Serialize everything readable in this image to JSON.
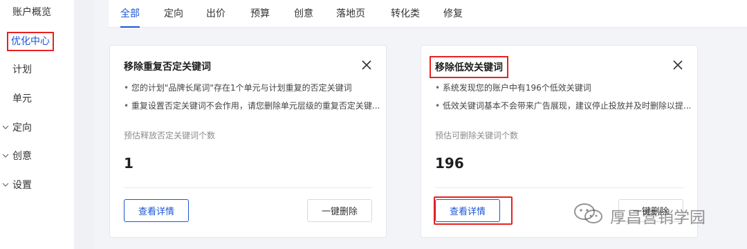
{
  "sidebar": {
    "items": [
      {
        "label": "账户概览"
      },
      {
        "label": "优化中心"
      },
      {
        "label": "计划"
      },
      {
        "label": "单元"
      }
    ],
    "groups": [
      {
        "label": "定向",
        "icon": "chevron-down-icon"
      },
      {
        "label": "创意",
        "icon": "chevron-down-icon"
      },
      {
        "label": "设置",
        "icon": "chevron-down-icon"
      }
    ],
    "active": "优化中心"
  },
  "tabs": [
    {
      "label": "全部"
    },
    {
      "label": "定向"
    },
    {
      "label": "出价"
    },
    {
      "label": "预算"
    },
    {
      "label": "创意"
    },
    {
      "label": "落地页"
    },
    {
      "label": "转化类"
    },
    {
      "label": "修复"
    }
  ],
  "active_tab": "全部",
  "cards": [
    {
      "title": "移除重复否定关键词",
      "bullets": [
        "您的计划\"品牌长尾词\"存在1个单元与计划重复的否定关键词",
        "重复设置否定关键词不会作用，请您删除单元层级的重复否定关键..."
      ],
      "estimate_label": "预估释放否定关键词个数",
      "estimate_value": "1",
      "details_button": "查看详情",
      "action_button": "一键删除"
    },
    {
      "title": "移除低效关键词",
      "bullets": [
        "系统发现您的账户中有196个低效关键词",
        "低效关键词基本不会带来广告展现，建议停止投放并及时删除以提..."
      ],
      "estimate_label": "预估可删除关键词个数",
      "estimate_value": "196",
      "details_button": "查看详情",
      "action_button": "一键删除"
    }
  ],
  "watermark": {
    "text": "厚昌营销学园",
    "icon": "wechat-icon"
  },
  "colors": {
    "accent": "#1a55d6",
    "highlight": "#e82020"
  }
}
